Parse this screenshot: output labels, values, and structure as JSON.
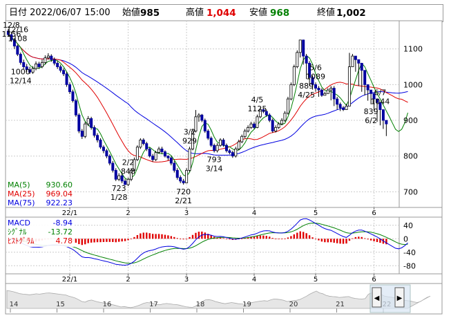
{
  "header": {
    "datetime": "日付 2022/06/07 15:00",
    "open_label": "始値",
    "open_value": "985",
    "high_label": "高値",
    "high_value": "1,044",
    "low_label": "安値",
    "low_value": "968",
    "close_label": "終値",
    "close_value": "1,002",
    "colors": {
      "high": "#e00000",
      "low": "#008000",
      "text": "#000000"
    }
  },
  "chart_data": [
    {
      "type": "candlestick",
      "panel": "price",
      "ylim": [
        660,
        1175
      ],
      "yticks": [
        700,
        800,
        900,
        1000,
        1100
      ],
      "xticks": [
        {
          "i": 20,
          "label": "22/1"
        },
        {
          "i": 39,
          "label": "2"
        },
        {
          "i": 58,
          "label": "3"
        },
        {
          "i": 80,
          "label": "4"
        },
        {
          "i": 100,
          "label": "5"
        },
        {
          "i": 119,
          "label": "6"
        }
      ],
      "n_bars": 124,
      "close": [
        1140,
        1125,
        1108,
        1085,
        1062,
        1050,
        1042,
        1035,
        1045,
        1058,
        1050,
        1062,
        1075,
        1080,
        1070,
        1060,
        1050,
        1040,
        1030,
        1000,
        980,
        955,
        915,
        870,
        855,
        890,
        905,
        880,
        858,
        845,
        825,
        815,
        800,
        780,
        760,
        735,
        745,
        730,
        720,
        735,
        760,
        790,
        825,
        845,
        835,
        820,
        800,
        790,
        810,
        820,
        812,
        800,
        795,
        780,
        760,
        740,
        730,
        725,
        760,
        820,
        870,
        910,
        915,
        900,
        870,
        850,
        830,
        815,
        830,
        845,
        830,
        815,
        810,
        800,
        820,
        840,
        855,
        870,
        880,
        890,
        880,
        910,
        930,
        925,
        915,
        900,
        870,
        880,
        890,
        900,
        920,
        960,
        1000,
        1050,
        1090,
        1125,
        1080,
        1060,
        1020,
        1000,
        990,
        985,
        970,
        975,
        985,
        990,
        960,
        945,
        935,
        930,
        940,
        1050,
        1080,
        1070,
        1060,
        1040,
        1000,
        985,
        975,
        960,
        950,
        930,
        900,
        890,
        880,
        860,
        845,
        870,
        920,
        970,
        1002
      ],
      "open": [
        1150,
        1140,
        1125,
        1108,
        1085,
        1062,
        1050,
        1042,
        1035,
        1045,
        1058,
        1050,
        1062,
        1075,
        1080,
        1070,
        1060,
        1050,
        1040,
        1030,
        1000,
        980,
        955,
        915,
        870,
        855,
        890,
        905,
        880,
        858,
        845,
        825,
        815,
        800,
        780,
        760,
        735,
        745,
        730,
        720,
        735,
        760,
        790,
        825,
        845,
        835,
        820,
        800,
        790,
        810,
        820,
        812,
        800,
        795,
        780,
        760,
        740,
        730,
        725,
        760,
        820,
        870,
        910,
        915,
        900,
        870,
        850,
        830,
        815,
        830,
        845,
        830,
        815,
        810,
        800,
        820,
        840,
        855,
        870,
        880,
        890,
        880,
        910,
        930,
        925,
        915,
        900,
        870,
        880,
        890,
        900,
        920,
        960,
        1000,
        1050,
        1090,
        1125,
        1080,
        1060,
        1020,
        1000,
        990,
        985,
        970,
        975,
        985,
        990,
        960,
        945,
        935,
        930,
        940,
        1050,
        1080,
        1070,
        1060,
        1040,
        1000,
        985,
        975,
        960,
        950,
        930,
        900,
        890,
        880,
        860,
        845,
        870,
        920,
        985
      ],
      "high": [
        1156,
        1148,
        1130,
        1112,
        1090,
        1070,
        1058,
        1050,
        1052,
        1065,
        1064,
        1070,
        1082,
        1088,
        1085,
        1076,
        1066,
        1056,
        1046,
        1036,
        1006,
        986,
        960,
        920,
        876,
        896,
        912,
        910,
        886,
        864,
        850,
        830,
        820,
        805,
        786,
        766,
        752,
        752,
        736,
        740,
        766,
        796,
        830,
        850,
        850,
        840,
        825,
        806,
        815,
        826,
        826,
        816,
        802,
        800,
        786,
        766,
        746,
        736,
        766,
        826,
        876,
        929,
        920,
        918,
        905,
        875,
        855,
        835,
        836,
        850,
        850,
        835,
        820,
        815,
        826,
        846,
        860,
        876,
        886,
        896,
        896,
        916,
        936,
        935,
        930,
        920,
        905,
        886,
        895,
        906,
        926,
        966,
        1006,
        1056,
        1096,
        1125,
        1126,
        1086,
        1066,
        1026,
        1006,
        996,
        990,
        980,
        990,
        996,
        996,
        966,
        950,
        940,
        946,
        1089,
        1086,
        1080,
        1066,
        1046,
        1006,
        990,
        980,
        966,
        956,
        936,
        906,
        896,
        886,
        866,
        850,
        876,
        926,
        976,
        1044
      ],
      "low": [
        1134,
        1120,
        1100,
        1080,
        1056,
        1044,
        1036,
        1030,
        1030,
        1040,
        1044,
        1046,
        1056,
        1070,
        1064,
        1054,
        1044,
        1034,
        1024,
        994,
        974,
        950,
        910,
        864,
        848,
        850,
        884,
        874,
        852,
        838,
        820,
        808,
        794,
        774,
        754,
        730,
        730,
        724,
        723,
        716,
        730,
        756,
        786,
        820,
        830,
        814,
        796,
        784,
        786,
        806,
        806,
        796,
        788,
        774,
        754,
        734,
        724,
        720,
        724,
        756,
        816,
        866,
        896,
        895,
        865,
        845,
        825,
        810,
        810,
        826,
        826,
        810,
        805,
        795,
        796,
        816,
        836,
        850,
        866,
        876,
        876,
        878,
        906,
        920,
        910,
        895,
        865,
        866,
        876,
        886,
        896,
        916,
        956,
        996,
        1046,
        1076,
        1056,
        1016,
        996,
        986,
        980,
        966,
        966,
        972,
        982,
        956,
        940,
        930,
        926,
        926,
        936,
        1046,
        1056,
        1036,
        996,
        980,
        970,
        955,
        945,
        926,
        896,
        886,
        876,
        856,
        839,
        842,
        866,
        918,
        968
      ],
      "ma": {
        "MA(5)": {
          "label_value": "930.60"
        },
        "MA(25)": {
          "label_value": "969.04"
        },
        "MA(75)": {
          "label_value": "922.23"
        }
      },
      "ma_colors": {
        "MA(5)": "#008000",
        "MA(25)": "#e00000",
        "MA(75)": "#0000e0"
      },
      "annotations": [
        {
          "i": 1,
          "date": "12/8",
          "value": "1156",
          "pos": "above"
        },
        {
          "i": 3,
          "date": "12/16",
          "value": "1108",
          "pos": "above"
        },
        {
          "i": 4,
          "date": "1000",
          "value": "12/14",
          "pos": "below"
        },
        {
          "i": 36,
          "date": "723",
          "value": "1/28",
          "pos": "below"
        },
        {
          "i": 39,
          "date": "2/2",
          "value": "848",
          "pos": "above"
        },
        {
          "i": 57,
          "date": "720",
          "value": "2/21",
          "pos": "below"
        },
        {
          "i": 59,
          "date": "3/2",
          "value": "929",
          "pos": "above"
        },
        {
          "i": 67,
          "date": "793",
          "value": "3/14",
          "pos": "below"
        },
        {
          "i": 81,
          "date": "4/5",
          "value": "1125",
          "pos": "above"
        },
        {
          "i": 97,
          "date": "889",
          "value": "4/25",
          "pos": "below"
        },
        {
          "i": 100,
          "date": "5/6",
          "value": "1089",
          "pos": "above"
        },
        {
          "i": 118,
          "date": "839",
          "value": "6/2",
          "pos": "below"
        },
        {
          "i": 121,
          "date": "6/7",
          "value": "1044",
          "pos": "above"
        }
      ]
    },
    {
      "type": "line",
      "panel": "macd",
      "ylim": [
        -100,
        60
      ],
      "yticks": [
        40,
        0,
        -40,
        -80
      ],
      "series_labels": [
        {
          "name": "MACD",
          "value": "-8.94",
          "color": "#0000e0"
        },
        {
          "name": "ｼｸﾞﾅﾙ",
          "value": "-13.72",
          "color": "#008000"
        },
        {
          "name": "ﾋｽﾄｸﾞﾗﾑ",
          "value": "4.78",
          "color": "#e00000"
        }
      ]
    },
    {
      "type": "area",
      "panel": "navigator",
      "labels": [
        "14",
        "15",
        "16",
        "17",
        "18",
        "19",
        "20",
        "21",
        "22"
      ]
    }
  ],
  "navigator": {
    "left_arrow": "◀",
    "right_arrow": "▶"
  }
}
